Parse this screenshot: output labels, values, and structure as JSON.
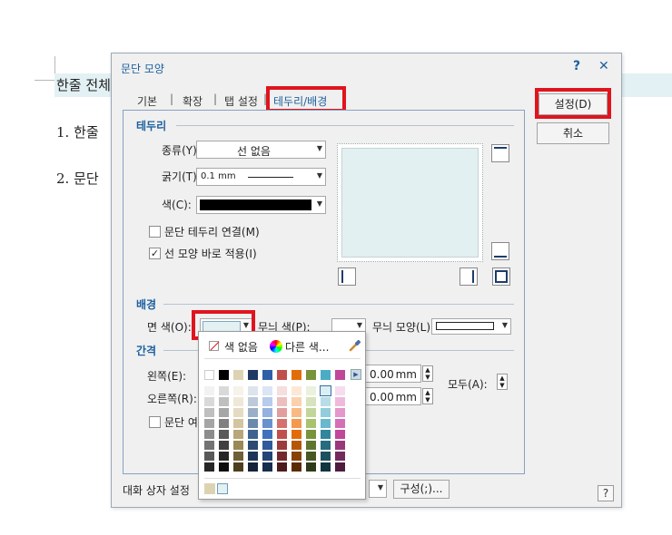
{
  "document": {
    "line1": "한줄 전체",
    "line2": "1. 한줄",
    "line3": "2. 문단"
  },
  "dialog": {
    "title": "문단 모양",
    "help_glyph": "?",
    "close_glyph": "✕",
    "tabs": [
      {
        "label": "기본"
      },
      {
        "label": "확장"
      },
      {
        "label": "탭 설정"
      },
      {
        "label": "테두리/배경"
      }
    ],
    "tab_separator": "|",
    "buttons": {
      "ok": "설정(D)",
      "cancel": "취소"
    },
    "border": {
      "section_title": "테두리",
      "type_label": "종류(Y):",
      "type_value": "선 없음",
      "thickness_label": "굵기(T):",
      "thickness_value": "0.1 mm",
      "color_label": "색(C):",
      "color_value": "#000000",
      "connect_label": "문단 테두리 연결(M)",
      "connect_checked": false,
      "apply_label": "선 모양 바로 적용(I)",
      "apply_checked": true
    },
    "background": {
      "section_title": "배경",
      "face_color_label": "면 색(O):",
      "face_color_value": "#e3f1f3",
      "pattern_color_label": "무늬 색(P):",
      "pattern_shape_label": "무늬 모양(L):"
    },
    "spacing": {
      "section_title": "간격",
      "left_label": "왼쪽(E):",
      "left_value": "0.00",
      "right_label": "오른쪽(R):",
      "right_value": "0.00",
      "unit": "mm",
      "all_label": "모두(A):",
      "ignore_label": "문단 여"
    },
    "footer": {
      "settings_label": "대화 상자 설정",
      "compose_label": "구성(;)..."
    },
    "help_button": "?"
  },
  "palette": {
    "no_color": "색 없음",
    "other_color": "다른 색...",
    "eyedropper_icon": "eyedropper-icon",
    "accent_red": "#e0141e"
  }
}
